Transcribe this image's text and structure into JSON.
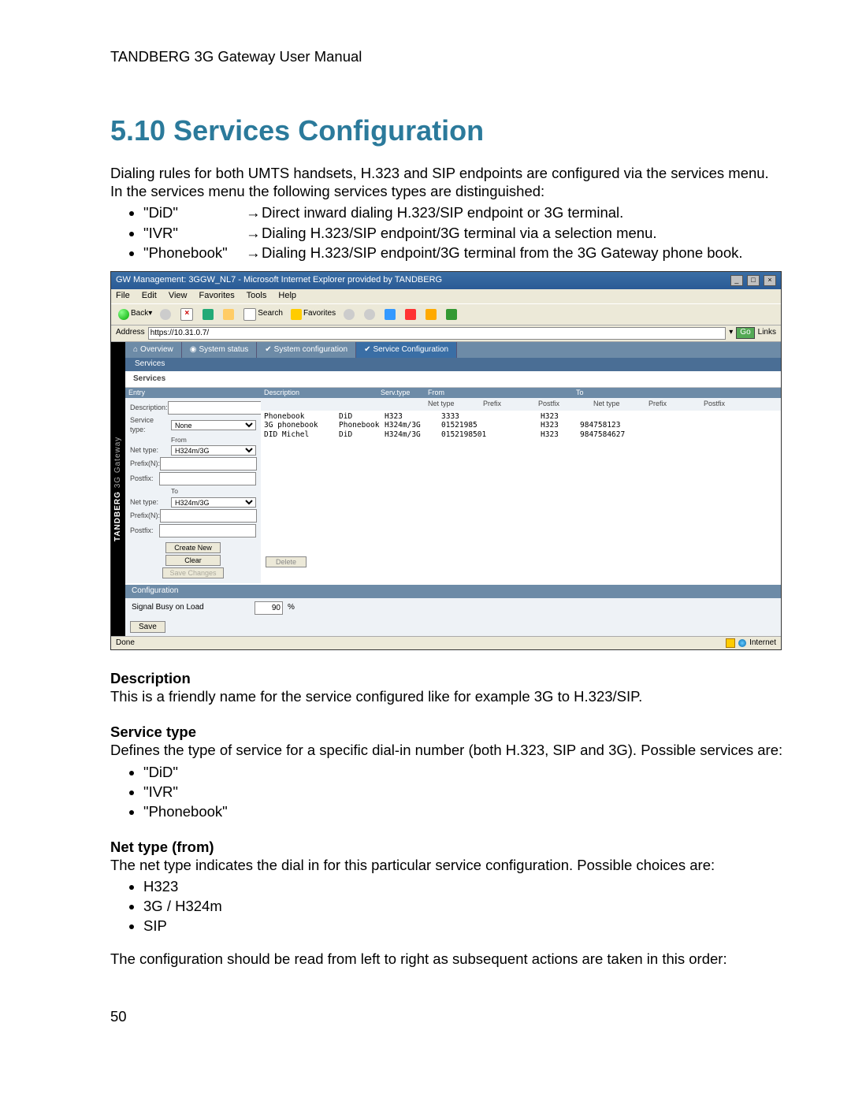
{
  "header": "TANDBERG 3G Gateway User Manual",
  "title": "5.10 Services Configuration",
  "intro": "Dialing rules for both UMTS handsets, H.323 and SIP endpoints are configured via the services menu. In the services menu the following services types are distinguished:",
  "svc_types": [
    {
      "key": "\"DiD\"",
      "arrow": "→",
      "desc": "Direct inward dialing H.323/SIP endpoint or 3G terminal."
    },
    {
      "key": "\"IVR\"",
      "arrow": "→",
      "desc": "Dialing H.323/SIP endpoint/3G terminal via a selection menu."
    },
    {
      "key": "\"Phonebook\"",
      "arrow": "→",
      "desc": "Dialing H.323/SIP endpoint/3G terminal from the 3G Gateway phone book."
    }
  ],
  "win": {
    "title": "GW Management: 3GGW_NL7 - Microsoft Internet Explorer provided by TANDBERG",
    "menu": [
      "File",
      "Edit",
      "View",
      "Favorites",
      "Tools",
      "Help"
    ],
    "back": "Back",
    "search": "Search",
    "fav": "Favorites",
    "addr_label": "Address",
    "addr_value": "https://10.31.0.7/",
    "go": "Go",
    "links": "Links",
    "tabs": [
      "Overview",
      "System status",
      "System configuration",
      "Service Configuration"
    ],
    "subnav": "Services",
    "svc_title": "Services",
    "form": {
      "hdr": "Entry",
      "desc": "Description:",
      "stype": "Service type:",
      "stype_val": "None",
      "from": "From",
      "to": "To",
      "nettype": "Net type:",
      "nettype_val": "H324m/3G",
      "prefix": "Prefix(N):",
      "postfix": "Postfix:",
      "btn_create": "Create New",
      "btn_clear": "Clear",
      "btn_save": "Save Changes"
    },
    "thdr": {
      "desc": "Description",
      "serv": "Serv.type",
      "from": "From",
      "to": "To"
    },
    "subthdr": {
      "nettype": "Net type",
      "prefix": "Prefix",
      "postfix": "Postfix"
    },
    "rows": [
      {
        "d": "Phonebook",
        "t": "DiD",
        "fnt": "H323",
        "fpre": "3333",
        "fpost": "",
        "tnt": "H323",
        "tpre": "",
        "tpost": ""
      },
      {
        "d": "3G phonebook",
        "t": "Phonebook",
        "fnt": "H324m/3G",
        "fpre": "01521985",
        "fpost": "",
        "tnt": "H323",
        "tpre": "984758123",
        "tpost": ""
      },
      {
        "d": "DID Michel",
        "t": "DiD",
        "fnt": "H324m/3G",
        "fpre": "0152198501",
        "fpost": "",
        "tnt": "H323",
        "tpre": "9847584627",
        "tpost": ""
      }
    ],
    "delete": "Delete",
    "conf_hdr": "Configuration",
    "conf_lbl": "Signal Busy on Load",
    "conf_val": "90",
    "conf_unit": "%",
    "save": "Save",
    "status_left": "Done",
    "status_right": "Internet",
    "vlabel_bold": "TANDBERG",
    "vlabel_rest": " 3G Gateway"
  },
  "sec_desc_h": "Description",
  "sec_desc_t": "This is a friendly name for the service configured like for example 3G to H.323/SIP.",
  "sec_type_h": "Service type",
  "sec_type_t": "Defines the type of service for a specific dial-in number (both H.323, SIP and 3G). Possible services are:",
  "sec_type_b": [
    "\"DiD\"",
    "\"IVR\"",
    "\"Phonebook\""
  ],
  "sec_nt_h": "Net type (from)",
  "sec_nt_t": "The net type indicates the dial in for this particular service configuration. Possible choices are:",
  "sec_nt_b": [
    "H323",
    "3G / H324m",
    "SIP"
  ],
  "closing": "The configuration should be read from left to right as subsequent actions are taken in this order:",
  "page_num": "50"
}
